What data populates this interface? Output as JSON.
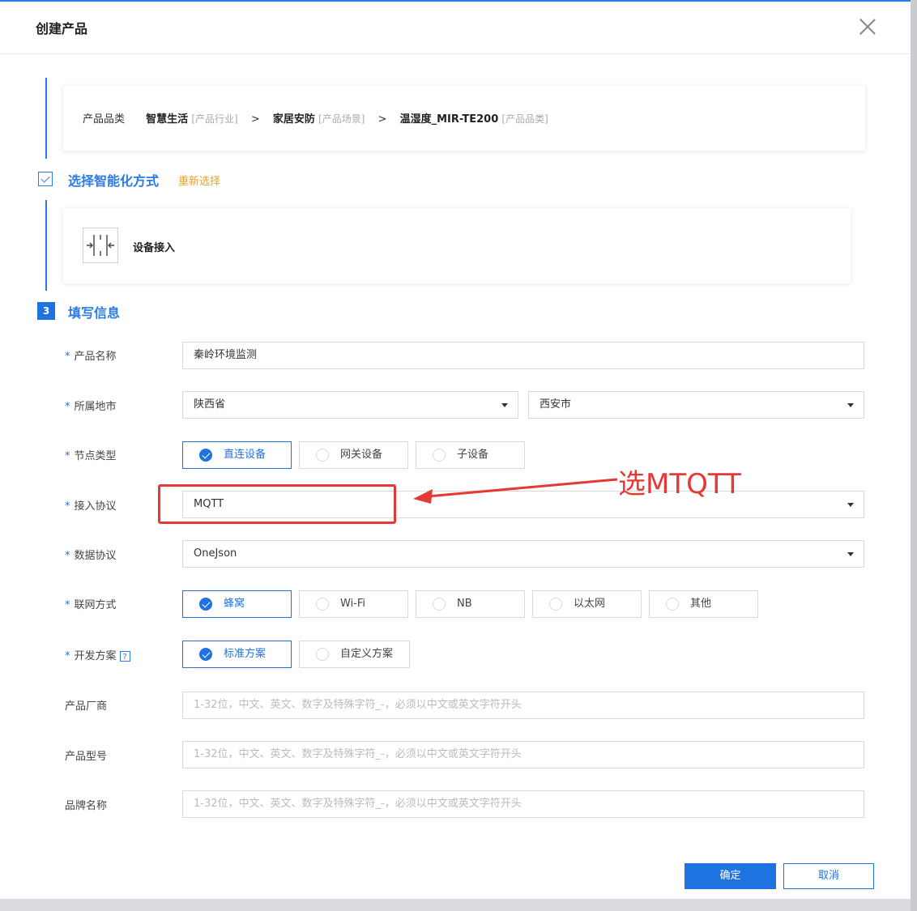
{
  "dialog": {
    "title": "创建产品"
  },
  "category": {
    "label": "产品品类",
    "industry": "智慧生活",
    "industry_tag": "[产品行业]",
    "scene": "家居安防",
    "scene_tag": "[产品场景]",
    "product_category": "温湿度_MIR-TE200",
    "product_category_tag": "[产品品类]",
    "separator": ">"
  },
  "step2": {
    "title": "选择智能化方式",
    "reselect": "重新选择",
    "mode_label": "设备接入"
  },
  "step3": {
    "number": "3",
    "title": "填写信息"
  },
  "form": {
    "required_mark": "*",
    "product_name": {
      "label": "产品名称",
      "value": "秦岭环境监测"
    },
    "city": {
      "label": "所属地市",
      "province": "陕西省",
      "city": "西安市"
    },
    "node_type": {
      "label": "节点类型",
      "options": [
        "直连设备",
        "网关设备",
        "子设备"
      ],
      "selected": 0
    },
    "protocol": {
      "label": "接入协议",
      "value": "MQTT"
    },
    "data_protocol": {
      "label": "数据协议",
      "value": "OneJson"
    },
    "network": {
      "label": "联网方式",
      "options": [
        "蜂窝",
        "Wi-Fi",
        "NB",
        "以太网",
        "其他"
      ],
      "selected": 0
    },
    "dev_plan": {
      "label": "开发方案",
      "help": "?",
      "options": [
        "标准方案",
        "自定义方案"
      ],
      "selected": 0
    },
    "vendor": {
      "label": "产品厂商",
      "placeholder": "1-32位，中文、英文、数字及特殊字符_-，必须以中文或英文字符开头"
    },
    "model": {
      "label": "产品型号",
      "placeholder": "1-32位，中文、英文、数字及特殊字符_-，必须以中文或英文字符开头"
    },
    "brand": {
      "label": "品牌名称",
      "placeholder": "1-32位，中文、英文、数字及特殊字符_-，必须以中文或英文字符开头"
    }
  },
  "annotation": {
    "text": "选MTQTT",
    "color": "#e53935"
  },
  "footer": {
    "ok": "确定",
    "cancel": "取消"
  },
  "colors": {
    "accent": "#1f73e0",
    "warning": "#e8a22c"
  },
  "icons": [
    "close-icon",
    "check-icon",
    "device-access-icon",
    "dropdown-caret-icon",
    "radio-check-icon",
    "help-icon",
    "arrow-icon"
  ]
}
